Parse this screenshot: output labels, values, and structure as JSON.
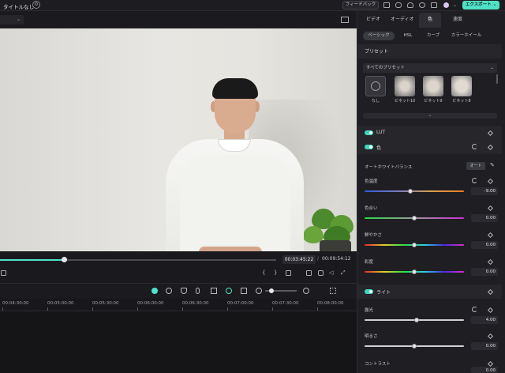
{
  "topbar": {
    "title": "タイトルなし",
    "feedback_label": "フィードバック",
    "export_label": "エクスポート",
    "export_chevron": "⌄"
  },
  "player": {
    "zoom_chevron": "⌄",
    "progress": 0.23,
    "time_current": "00:03:45:22",
    "time_separator": "/",
    "time_total": "00:09:54:12",
    "controls": {
      "mark_in": "{",
      "mark_out": "}"
    }
  },
  "timeline": {
    "ruler_labels": [
      "00:04:30:00",
      "00:05:00:00",
      "00:05:30:00",
      "00:06:00:00",
      "00:06:30:00",
      "00:07:00:00",
      "00:07:30:00",
      "00:08:00:00"
    ]
  },
  "panel": {
    "tabs": [
      "ビデオ",
      "オーディオ",
      "色",
      "速度"
    ],
    "active_tab": "色",
    "subtabs": [
      "ベーシック",
      "HSL",
      "カーブ",
      "カラーホイール"
    ],
    "active_subtab": "ベーシック",
    "preset_section": "プリセット",
    "preset_dropdown": "すべてのプリセット",
    "presets": [
      {
        "label": "なし"
      },
      {
        "label": "ビネット10"
      },
      {
        "label": "ビネット9"
      },
      {
        "label": "ビネット8"
      }
    ],
    "expand_label": "⌄",
    "lut_label": "LUT",
    "color_label": "色",
    "awb_label": "オートホワイトバランス",
    "auto_button": "オート",
    "sliders": [
      {
        "label": "色温度",
        "value": "-9.00",
        "level": 0.46
      },
      {
        "label": "色合い",
        "value": "0.00",
        "level": 0.5
      },
      {
        "label": "鮮やかさ",
        "value": "0.00",
        "level": 0.5
      },
      {
        "label": "彩度",
        "value": "0.00",
        "level": 0.5
      }
    ],
    "light_label": "ライト",
    "light_sliders": [
      {
        "label": "露光",
        "value": "4.00",
        "level": 0.52
      },
      {
        "label": "明るさ",
        "value": "0.00",
        "level": 0.5
      },
      {
        "label": "コントラスト",
        "value": "0.00",
        "level": 0.5
      }
    ]
  },
  "colors": {
    "accent": "#4fe1c8",
    "panel_bg": "#1f1f23",
    "app_bg": "#151518"
  }
}
